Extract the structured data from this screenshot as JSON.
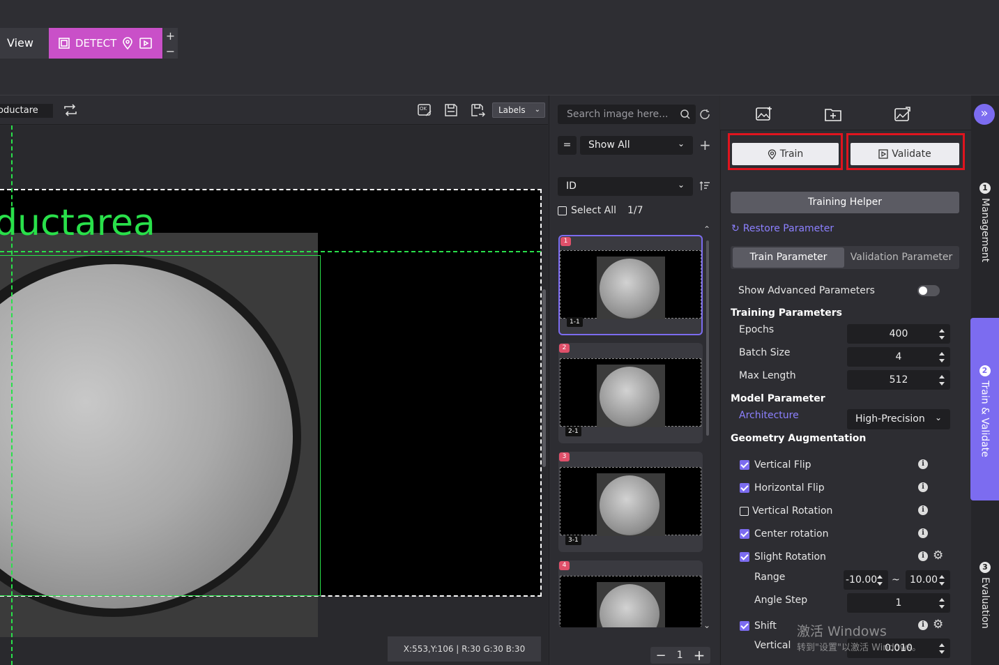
{
  "tabs": {
    "view": "View",
    "detect": "DETECT"
  },
  "toolbar": {
    "image_name": "roductare",
    "labels_select": "Labels"
  },
  "canvas": {
    "label_text": "ductarea",
    "status": "X:553,Y:106 | R:30 G:30 B:30"
  },
  "gallery": {
    "search_placeholder": "Search image here...",
    "filter_op": "=",
    "filter_value": "Show All",
    "sort_field": "ID",
    "select_all": "Select All",
    "count": "1/7",
    "items": [
      {
        "badge": "1",
        "id": "1-1"
      },
      {
        "badge": "2",
        "id": "2-1"
      },
      {
        "badge": "3",
        "id": "3-1"
      },
      {
        "badge": "4",
        "id": ""
      }
    ],
    "page": "1"
  },
  "panel": {
    "train_button": "Train",
    "validate_button": "Validate",
    "training_helper": "Training Helper",
    "restore": "Restore Parameter",
    "tab_train": "Train Parameter",
    "tab_validate": "Validation Parameter",
    "show_advanced": "Show Advanced Parameters",
    "training_params_title": "Training Parameters",
    "epochs_label": "Epochs",
    "epochs": "400",
    "batch_label": "Batch Size",
    "batch": "4",
    "maxlen_label": "Max Length",
    "maxlen": "512",
    "model_title": "Model Parameter",
    "arch_label": "Architecture",
    "arch": "High-Precision",
    "geo_title": "Geometry Augmentation",
    "vflip": "Vertical Flip",
    "hflip": "Horizontal Flip",
    "vrot": "Vertical Rotation",
    "crot": "Center rotation",
    "srot": "Slight Rotation",
    "range_label": "Range",
    "range_min": "-10.00",
    "range_sep": "~",
    "range_max": "10.00",
    "angle_label": "Angle Step",
    "angle": "1",
    "shift": "Shift",
    "vertical_label": "Vertical",
    "vertical": "0.010"
  },
  "sidebar": {
    "management": "Management",
    "train_validate": "Train & Validate",
    "evaluation": "Evaluation",
    "n1": "1",
    "n2": "2",
    "n3": "3"
  },
  "watermark": {
    "line1": "激活 Windows",
    "line2": "转到\"设置\"以激活 Windows。"
  },
  "colors": {
    "accent": "#7c6cf0",
    "detect_tab": "#c950c8",
    "label_green": "#29e04a",
    "highlight_red": "#e0141e",
    "badge": "#e0506a"
  }
}
